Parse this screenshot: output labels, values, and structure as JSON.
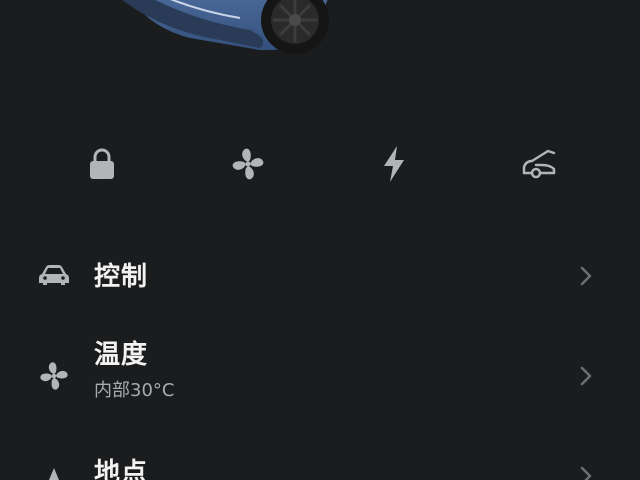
{
  "colors": {
    "background": "#1b1c1e",
    "icon": "#b3b4b7",
    "title": "#f2f2f2",
    "subtitle": "#a9aaad",
    "chevron": "#6d6e72",
    "car_body": "#4a6a9e"
  },
  "quick_actions": [
    {
      "icon": "lock-icon"
    },
    {
      "icon": "fan-icon"
    },
    {
      "icon": "lightning-bolt-icon"
    },
    {
      "icon": "trunk-open-icon"
    }
  ],
  "menu": {
    "controls": {
      "icon": "car-icon",
      "title": "控制"
    },
    "climate": {
      "icon": "fan-icon",
      "title": "温度",
      "subtitle": "内部30°C"
    },
    "location": {
      "icon": "location-arrow-icon",
      "title": "地点"
    }
  }
}
